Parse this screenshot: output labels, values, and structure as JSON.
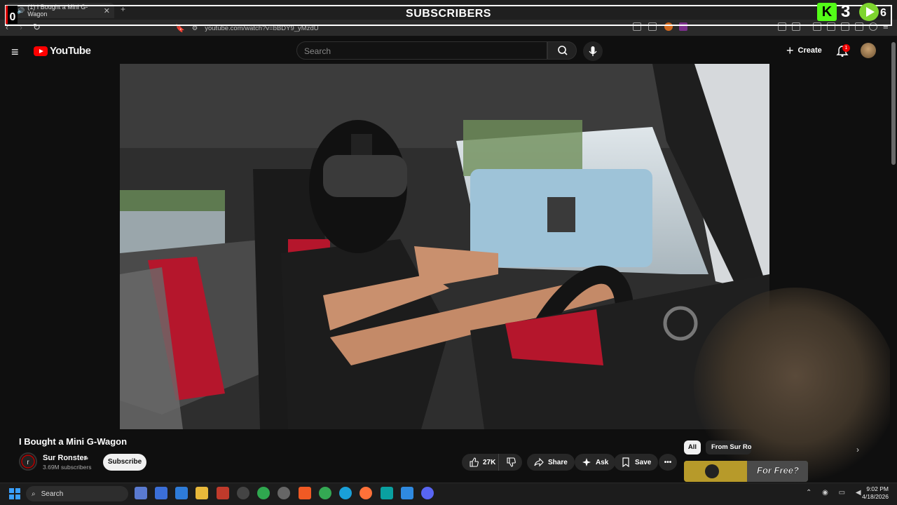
{
  "browser": {
    "tab_title": "(1) I Bought a Mini G-Wagon",
    "new_tab": "+",
    "url": "youtube.com/watch?v=bBDY9_yMzdU"
  },
  "overlay": {
    "title": "SUBSCRIBERS",
    "left_counter": "0",
    "kick_count": "3",
    "rumble_count": "6",
    "kick_color": "#53fc18",
    "rumble_color": "#7ed52f"
  },
  "youtube": {
    "logo_text": "YouTube",
    "search_placeholder": "Search",
    "create_label": "Create",
    "notification_count": "1",
    "accent": "#ff0000"
  },
  "video": {
    "title": "I Bought a Mini G-Wagon",
    "channel": "Sur Ronster",
    "subscribers": "3.69M subscribers",
    "subscribe_label": "Subscribe",
    "likes": "27K",
    "share_label": "Share",
    "ask_label": "Ask",
    "save_label": "Save"
  },
  "recommendations": {
    "chips": [
      "All",
      "From Sur Ronster"
    ],
    "thumb_text": "For Free?"
  },
  "taskbar": {
    "search_label": "Search",
    "time": "9:02 PM",
    "date": "4/18/2026"
  }
}
